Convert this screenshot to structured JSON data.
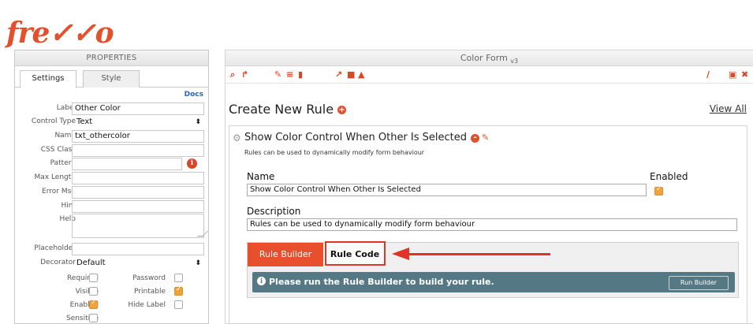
{
  "app": {
    "logo": "fre✓✓o"
  },
  "properties": {
    "header": "PROPERTIES",
    "tabs": [
      "Settings",
      "Style"
    ],
    "docs_link": "Docs",
    "fields": {
      "label": {
        "label": "Label",
        "value": "Other Color"
      },
      "control_type": {
        "label": "Control Type",
        "value": "Text"
      },
      "name": {
        "label": "Name",
        "value": "txt_othercolor"
      },
      "css_class": {
        "label": "CSS Class",
        "value": ""
      },
      "pattern": {
        "label": "Pattern",
        "value": ""
      },
      "max_length": {
        "label": "Max Length",
        "value": ""
      },
      "error_msg": {
        "label": "Error Msg",
        "value": ""
      },
      "hint": {
        "label": "Hint",
        "value": ""
      },
      "help": {
        "label": "Help",
        "value": ""
      },
      "placeholder": {
        "label": "Placeholder",
        "value": ""
      },
      "decorator": {
        "label": "Decorator",
        "value": "Default"
      }
    },
    "checkboxes": {
      "required": {
        "label": "Required",
        "checked": false
      },
      "password": {
        "label": "Password",
        "checked": false
      },
      "visible": {
        "label": "Visible",
        "checked": false
      },
      "printable": {
        "label": "Printable",
        "checked": true
      },
      "enabled": {
        "label": "Enabled",
        "checked": true
      },
      "hide_label": {
        "label": "Hide Label",
        "checked": false
      },
      "sensitive": {
        "label": "Sensitive",
        "checked": false
      }
    }
  },
  "form": {
    "title": "Color Form",
    "version": "v3",
    "create_rule": "Create New Rule",
    "view_all": "View All",
    "rule": {
      "name": "Show Color Control When Other Is Selected",
      "description_hint": "Rules can be used to dynamically modify form behaviour",
      "name_label": "Name",
      "name_value": "Show Color Control When Other Is Selected",
      "enabled_label": "Enabled",
      "enabled": true,
      "description_label": "Description",
      "description_value": "Rules can be used to dynamically modify form behaviour",
      "tab_builder": "Rule Builder",
      "tab_code": "Rule Code",
      "alert_text": "Please run the Rule Builder to build your rule.",
      "run_builder": "Run Builder"
    }
  },
  "colors": {
    "accent": "#e2502c",
    "alert_bg": "#557885",
    "highlight": "#e0332a"
  }
}
